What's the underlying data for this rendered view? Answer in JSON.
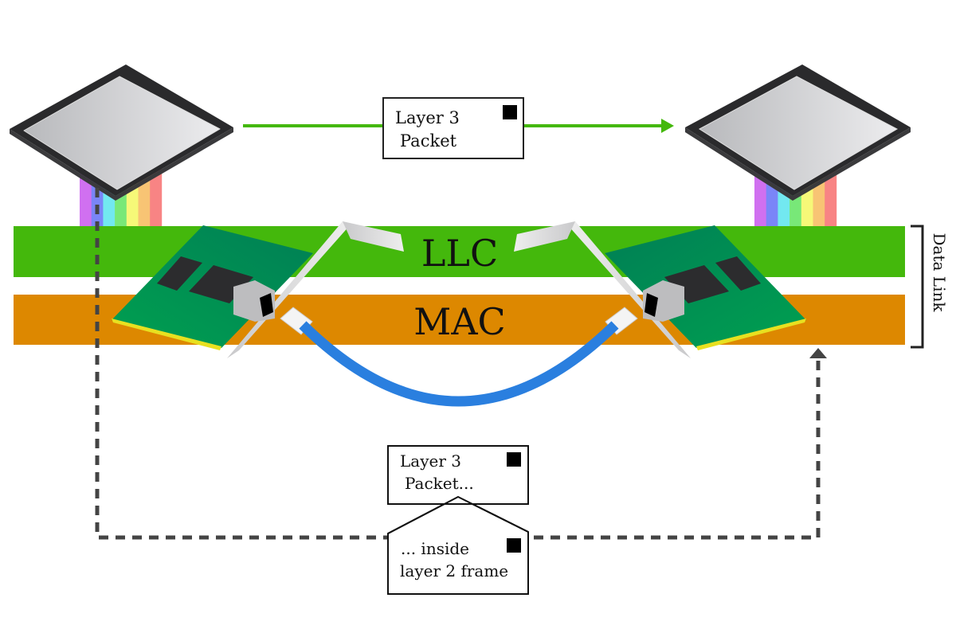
{
  "layers": {
    "llc": {
      "label": "LLC",
      "color": "#44b80c"
    },
    "mac": {
      "label": "MAC",
      "color": "#dd8800"
    },
    "group_label": "Data Link"
  },
  "top_packet": {
    "line1": "Layer 3",
    "line2": "Packet",
    "arrow_color": "#44b80c"
  },
  "bottom_packet": {
    "line1": "Layer 3",
    "line2": "Packet...",
    "frame_line1": "... inside",
    "frame_line2": "layer 2 frame",
    "path_color": "#444444"
  },
  "cable_color": "#2a7fdf",
  "rainbow": [
    "#d070f0",
    "#7a85f8",
    "#72e8f0",
    "#78e878",
    "#f6f878",
    "#f8c474",
    "#f88484"
  ],
  "icons": [
    "cpu-chip-icon",
    "network-card-icon",
    "ethernet-cable-icon",
    "envelope-icon"
  ]
}
